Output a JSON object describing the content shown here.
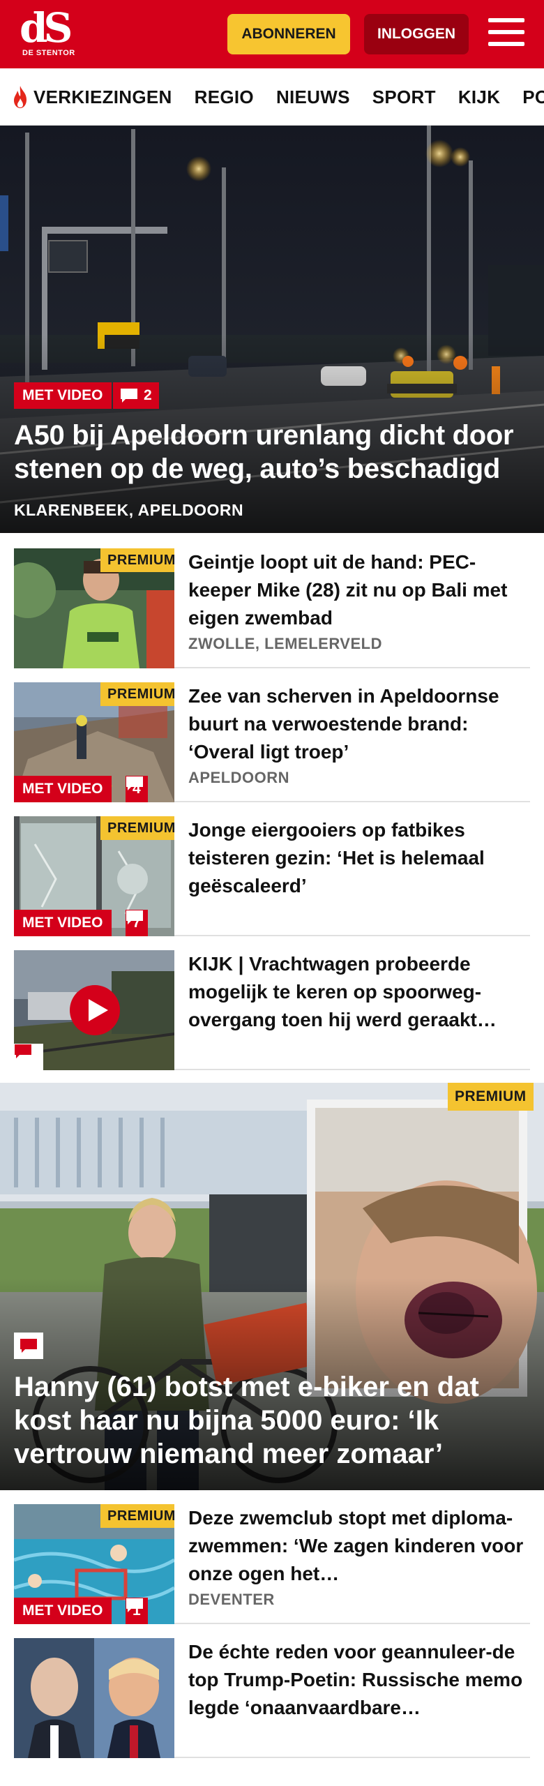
{
  "header": {
    "logo_mark": "dS",
    "logo_subtitle": "DE STENTOR",
    "subscribe_label": "ABONNEREN",
    "login_label": "INLOGGEN"
  },
  "nav": {
    "items": [
      "VERKIEZINGEN",
      "REGIO",
      "NIEUWS",
      "SPORT",
      "KIJK",
      "PODCASTS"
    ]
  },
  "hero": {
    "video_label": "MET VIDEO",
    "comments": "2",
    "title": "A50 bij Apeldoorn urenlang dicht door stenen op de weg, auto’s beschadigd",
    "location": "KLARENBEEK, APELDOORN"
  },
  "articles": [
    {
      "premium": "PREMIUM",
      "title": "Geintje loopt uit de hand: PEC-keeper Mike (28) zit nu op Bali met eigen zwembad",
      "location": "ZWOLLE, LEMELERVELD"
    },
    {
      "premium": "PREMIUM",
      "video_label": "MET VIDEO",
      "comments": "4",
      "title": "Zee van scherven in Apeldoornse buurt na verwoestende brand: ‘Overal ligt troep’",
      "location": "APELDOORN"
    },
    {
      "premium": "PREMIUM",
      "video_label": "MET VIDEO",
      "comments": "7",
      "title": "Jonge eiergooiers op fatbikes teisteren gezin: ‘Het is helemaal geëscaleerd’"
    },
    {
      "title": "KIJK | Vrachtwagen probeerde mogelijk te keren op spoorweg-overgang toen hij werd geraakt…"
    }
  ],
  "feature": {
    "premium": "PREMIUM",
    "title": "Hanny (61) botst met e-biker en dat kost haar nu bijna 5000 euro: ‘Ik vertrouw niemand meer zomaar’"
  },
  "articles_bottom": [
    {
      "premium": "PREMIUM",
      "video_label": "MET VIDEO",
      "comments": "1",
      "title": "Deze zwemclub stopt met diploma-zwemmen: ‘We zagen kinderen voor onze ogen het…",
      "location": "DEVENTER"
    },
    {
      "title": "De échte reden voor geannuleer-de top Trump-Poetin: Russische memo legde ‘onaanvaardbare…"
    }
  ],
  "colors": {
    "brand_red": "#d4001a",
    "premium_yellow": "#f4c330",
    "login_dark_red": "#9a0010"
  }
}
